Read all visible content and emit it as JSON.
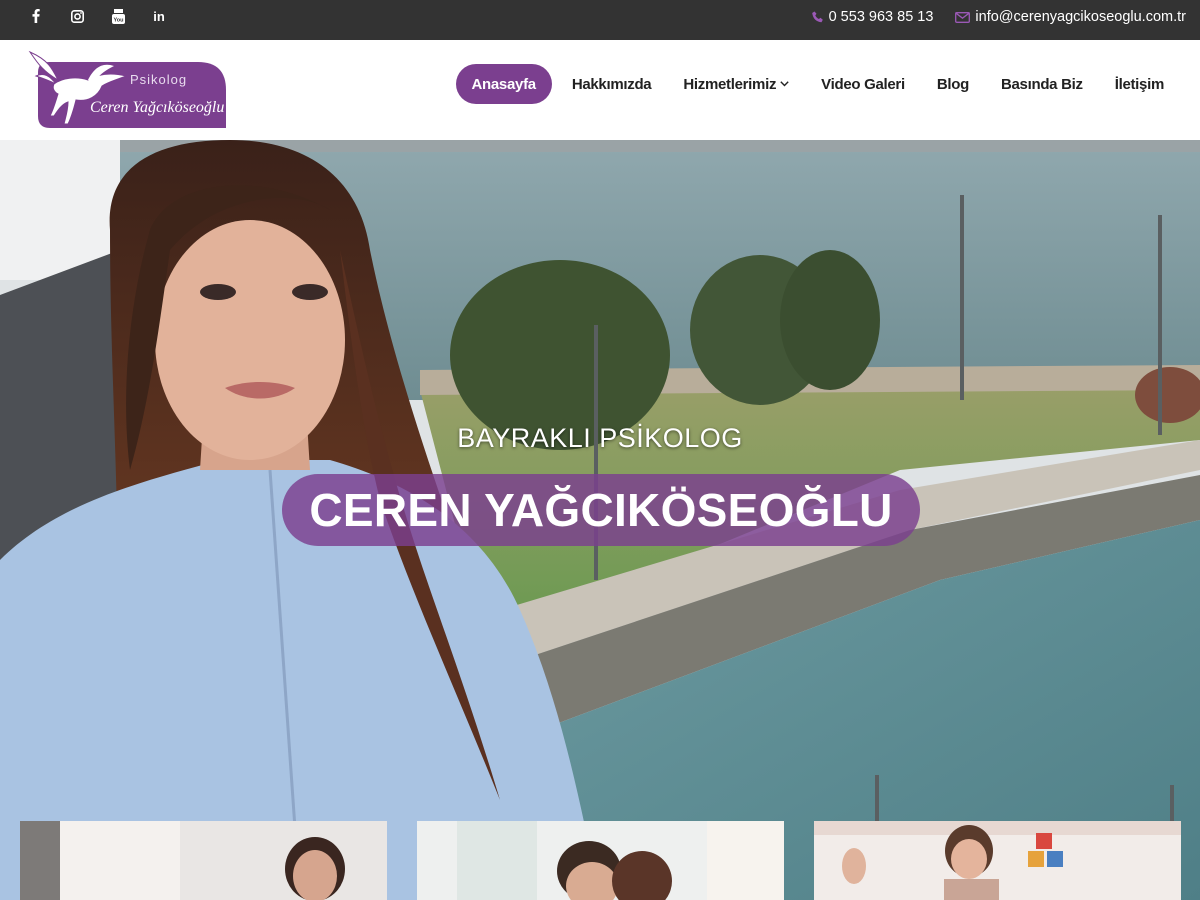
{
  "topbar": {
    "social": [
      {
        "name": "facebook-icon"
      },
      {
        "name": "instagram-icon"
      },
      {
        "name": "youtube-icon",
        "label": "You"
      },
      {
        "name": "linkedin-icon",
        "label": "in"
      }
    ],
    "phone": "0 553 963 85 13",
    "email": "info@cerenyagcikoseoglu.com.tr"
  },
  "logo": {
    "line1": "Psikolog",
    "line2": "Ceren Yağcıköseoğlu"
  },
  "nav": {
    "items": [
      {
        "label": "Anasayfa",
        "active": true
      },
      {
        "label": "Hakkımızda"
      },
      {
        "label": "Hizmetlerimiz",
        "has_dropdown": true
      },
      {
        "label": "Video Galeri"
      },
      {
        "label": "Blog"
      },
      {
        "label": "Basında Biz"
      },
      {
        "label": "İletişim"
      }
    ]
  },
  "hero": {
    "subtitle": "BAYRAKLI PSİKOLOG",
    "title": "CEREN YAĞCIKÖSEOĞLU"
  },
  "colors": {
    "brand": "#7b3f8f",
    "topbar": "#333333",
    "icon_accent": "#9b59b6"
  }
}
